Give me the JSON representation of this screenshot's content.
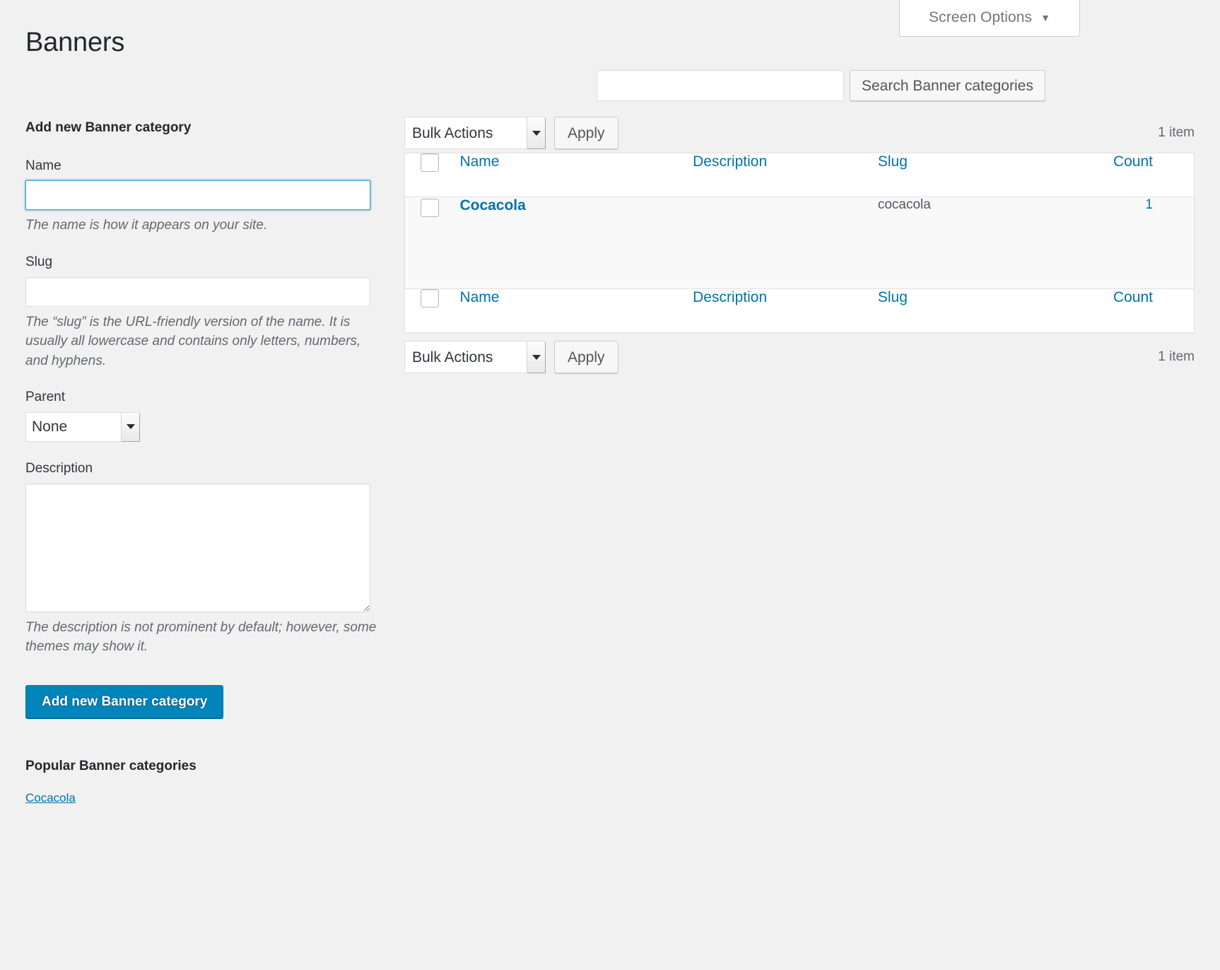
{
  "screen_options": {
    "label": "Screen Options",
    "arrow": "▼"
  },
  "page": {
    "title": "Banners"
  },
  "search": {
    "value": "",
    "placeholder": "",
    "button_label": "Search Banner categories"
  },
  "form": {
    "heading": "Add new Banner category",
    "name": {
      "label": "Name",
      "value": "",
      "hint": "The name is how it appears on your site."
    },
    "slug": {
      "label": "Slug",
      "value": "",
      "hint": "The “slug” is the URL-friendly version of the name. It is usually all lowercase and contains only letters, numbers, and hyphens."
    },
    "parent": {
      "label": "Parent",
      "selected": "None",
      "options": [
        "None"
      ]
    },
    "description": {
      "label": "Description",
      "value": "",
      "hint": "The description is not prominent by default; however, some themes may show it."
    },
    "submit_label": "Add new Banner category"
  },
  "popular": {
    "heading": "Popular Banner categories",
    "items": [
      "Cocacola"
    ]
  },
  "toolbar_top": {
    "bulk_actions_selected": "Bulk Actions",
    "bulk_actions_options": [
      "Bulk Actions"
    ],
    "apply_label": "Apply",
    "item_count": "1 item"
  },
  "toolbar_bottom": {
    "bulk_actions_selected": "Bulk Actions",
    "bulk_actions_options": [
      "Bulk Actions"
    ],
    "apply_label": "Apply",
    "item_count": "1 item"
  },
  "table": {
    "columns": [
      "Name",
      "Description",
      "Slug",
      "Count"
    ],
    "rows": [
      {
        "name": "Cocacola",
        "description": "",
        "slug": "cocacola",
        "count": "1"
      }
    ]
  },
  "colors": {
    "link": "#0073aa",
    "primary_button": "#0085ba",
    "page_background": "#f1f1f1",
    "row_background": "#f9f9f9",
    "focus_border": "#5b9dd9"
  }
}
